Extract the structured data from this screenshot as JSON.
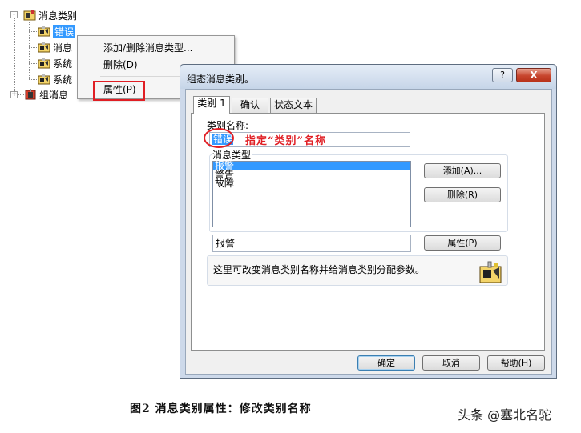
{
  "tree": {
    "root_label": "消息类别",
    "items": [
      {
        "label": "错误",
        "selected": true
      },
      {
        "label": "消息"
      },
      {
        "label": "系统"
      },
      {
        "label": "系统"
      }
    ],
    "group_label": "组消息",
    "expander_collapsed": "+",
    "expander_expanded": "-"
  },
  "context_menu": {
    "items": [
      {
        "label": "添加/删除消息类型..."
      },
      {
        "label": "删除(D)"
      },
      {
        "label": "属性(P)"
      }
    ]
  },
  "dialog": {
    "title": "组态消息类别。",
    "help_button": "?",
    "close_button": "X",
    "tabs": [
      {
        "label": "类别 1",
        "active": true
      },
      {
        "label": "确认"
      },
      {
        "label": "状态文本"
      }
    ],
    "category_name_label": "类别名称:",
    "category_name_value": "错误",
    "message_types_label": "消息类型",
    "message_types": [
      "报警",
      "警告",
      "故障"
    ],
    "selected_message_type": "报警",
    "add_button": "添加(A)...",
    "delete_button": "删除(R)",
    "property_value": "报警",
    "property_button": "属性(P)",
    "info_text": "这里可改变消息类别名称并给消息类别分配参数。",
    "ok_button": "确定",
    "cancel_button": "取消",
    "help_footer_button": "帮助(H)"
  },
  "annotation": {
    "text": "指定“类别”名称"
  },
  "caption": "图2 消息类别属性：修改类别名称",
  "watermark": "头条 @塞北名驼",
  "colors": {
    "selection": "#3399ff",
    "annotation_red": "#e01e24",
    "dialog_frame": "#cdd9ea"
  }
}
